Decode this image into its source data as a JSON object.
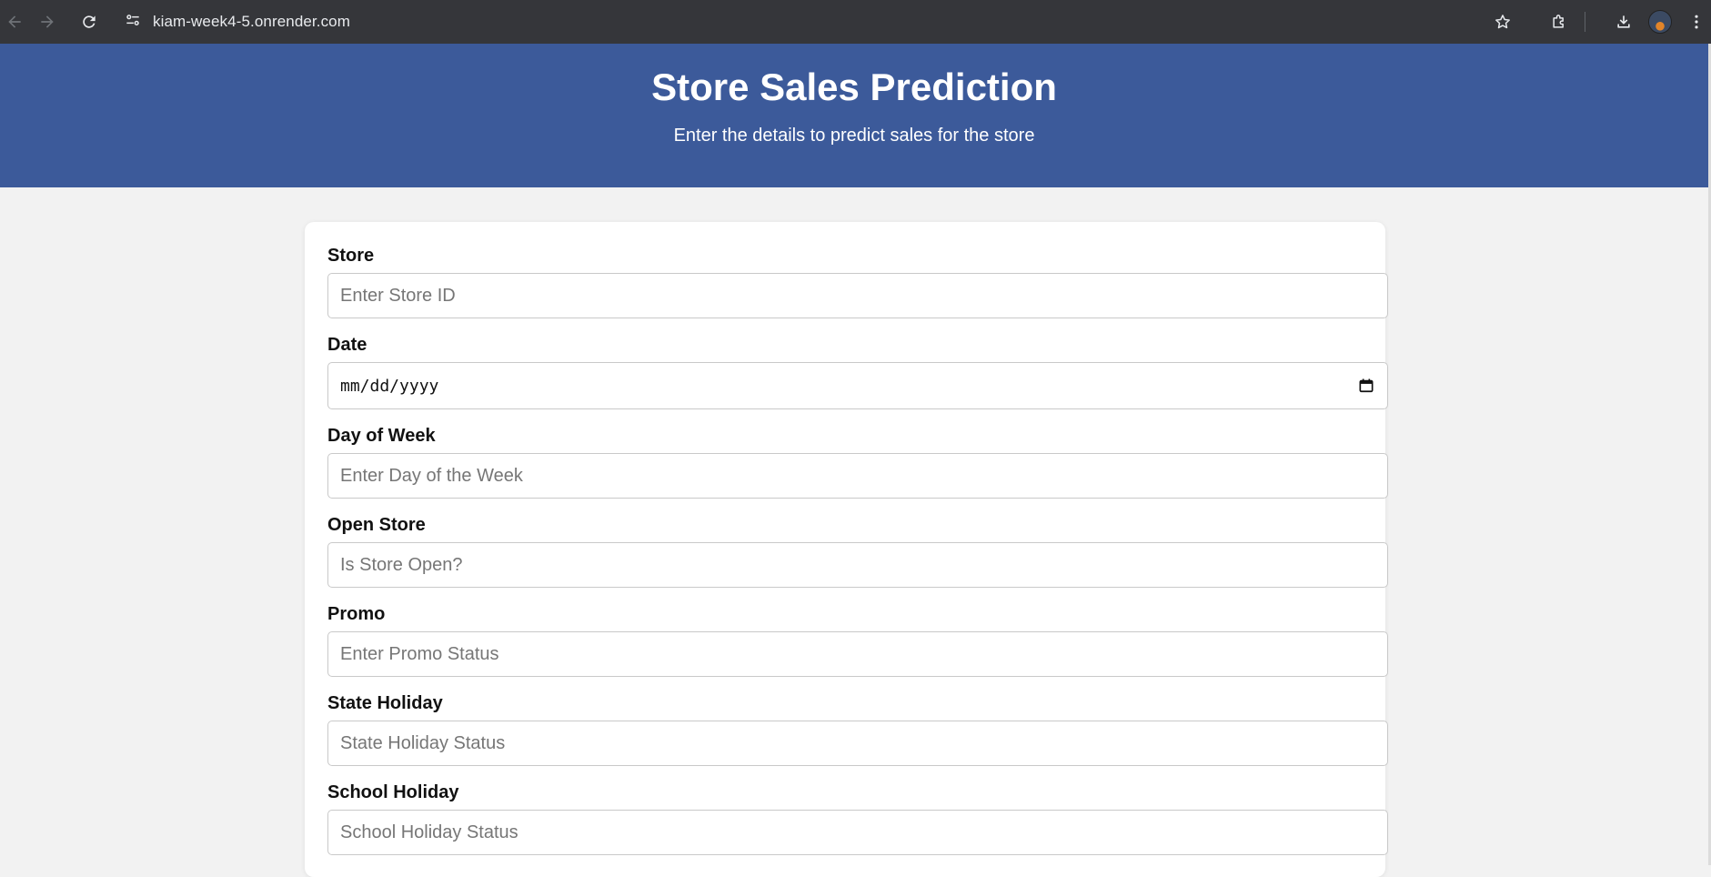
{
  "browser": {
    "url": "kiam-week4-5.onrender.com",
    "nav": {
      "back_icon": "arrow-left-icon",
      "forward_icon": "arrow-right-icon",
      "reload_icon": "reload-icon",
      "site_info_icon": "tune-icon"
    },
    "tools": [
      "star-icon",
      "extensions-icon",
      "download-icon",
      "avatar",
      "more-vert-icon"
    ]
  },
  "header": {
    "title": "Store Sales Prediction",
    "subtitle": "Enter the details to predict sales for the store"
  },
  "form": {
    "store": {
      "label": "Store",
      "placeholder": "Enter Store ID"
    },
    "date": {
      "label": "Date",
      "format": "mm/dd/yyyy"
    },
    "day_of_week": {
      "label": "Day of Week",
      "placeholder": "Enter Day of the Week"
    },
    "open_store": {
      "label": "Open Store",
      "placeholder": "Is Store Open?"
    },
    "promo": {
      "label": "Promo",
      "placeholder": "Enter Promo Status"
    },
    "state_holiday": {
      "label": "State Holiday",
      "placeholder": "State Holiday Status"
    },
    "school_holiday": {
      "label": "School Holiday",
      "placeholder": "School Holiday Status"
    }
  },
  "colors": {
    "browser_bar": "#35363a",
    "banner": "#3c5a9a",
    "page_bg": "#f2f2f2",
    "card_bg": "#ffffff"
  }
}
